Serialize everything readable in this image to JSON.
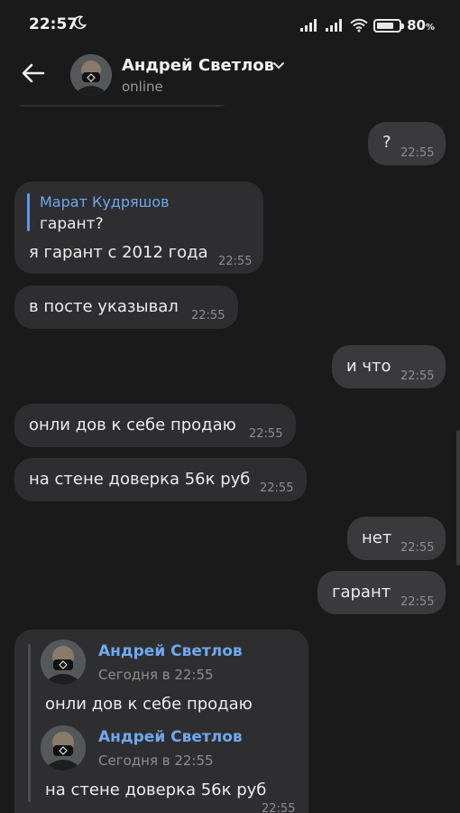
{
  "status_bar": {
    "time": "22:57",
    "battery_percent": "80",
    "battery_unit": "%",
    "battery_level": 0.8
  },
  "header": {
    "contact_name": "Андрей Светлов",
    "contact_status": "online"
  },
  "messages": [
    {
      "id": "m1",
      "direction": "outgoing",
      "text": "?",
      "time": "22:55"
    },
    {
      "id": "m2",
      "direction": "incoming",
      "reply_to": {
        "author": "Марат Кудряшов",
        "text": "гарант?"
      },
      "text": "я гарант с 2012 года",
      "time": "22:55"
    },
    {
      "id": "m3",
      "direction": "incoming",
      "text": "в посте указывал",
      "time": "22:55"
    },
    {
      "id": "m4",
      "direction": "outgoing",
      "text": "и что",
      "time": "22:55"
    },
    {
      "id": "m5",
      "direction": "incoming",
      "text": "онли дов к себе продаю",
      "time": "22:55"
    },
    {
      "id": "m6",
      "direction": "incoming",
      "text": "на стене доверка 56к руб",
      "time": "22:55"
    },
    {
      "id": "m7",
      "direction": "outgoing",
      "text": "нет",
      "time": "22:55"
    },
    {
      "id": "m8",
      "direction": "outgoing",
      "text": "гарант",
      "time": "22:55"
    },
    {
      "id": "m9",
      "direction": "incoming",
      "forwarded": [
        {
          "author": "Андрей Светлов",
          "date": "Сегодня в 22:55",
          "text": "онли дов к себе продаю"
        },
        {
          "author": "Андрей Светлов",
          "date": "Сегодня в 22:55",
          "text": "на стене доверка 56к руб"
        }
      ],
      "time": "22:55"
    }
  ],
  "colors": {
    "background": "#1a1a1a",
    "incoming_bubble": "#2e2e30",
    "outgoing_bubble": "#3a3a3c",
    "accent": "#6fa8ee"
  },
  "icons": {
    "back": "arrow-left-icon",
    "moon": "moon-icon",
    "chevron": "chevron-down-icon"
  }
}
